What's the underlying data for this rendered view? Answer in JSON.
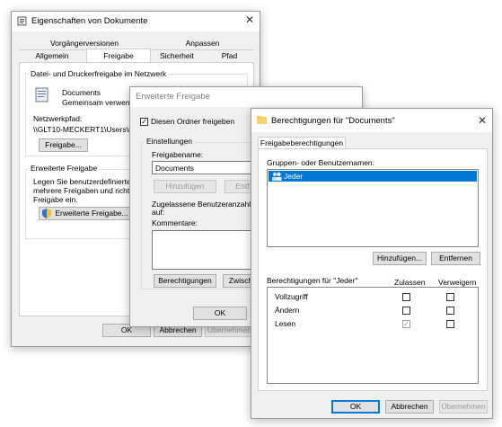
{
  "win1": {
    "title": "Eigenschaften von Dokumente",
    "tabs_row1": [
      "Vorgängerversionen",
      "Anpassen"
    ],
    "tabs_row2": [
      "Allgemein",
      "Freigabe",
      "Sicherheit",
      "Pfad"
    ],
    "net_group": "Datei- und Druckerfreigabe im Netzwerk",
    "folder_name": "Documents",
    "folder_status": "Gemeinsam verwendet",
    "path_label": "Netzwerkpfad:",
    "path_value": "\\\\GLT10-MECKERT1\\Users\\m",
    "share_button": "Freigabe...",
    "adv_group": "Erweiterte Freigabe",
    "adv_text1": "Legen Sie benutzerdefinierte Be",
    "adv_text2": "mehrere Freigaben und richten S",
    "adv_text3": "Freigabe ein.",
    "adv_button": "Erweiterte Freigabe...",
    "ok": "OK",
    "cancel": "Abbrechen",
    "apply": "Übernehmen"
  },
  "win2": {
    "title": "Erweiterte Freigabe",
    "share_check": "Diesen Ordner freigeben",
    "settings_group": "Einstellungen",
    "share_name_label": "Freigabename:",
    "share_name_value": "Documents",
    "add_button": "Hinzufügen",
    "remove_button": "Entf",
    "limit_label1": "Zugelassene Benutzeranzahl ei",
    "limit_label2": "auf:",
    "comments_label": "Kommentare:",
    "permissions_button": "Berechtigungen",
    "cache_button": "Zwisch",
    "ok": "OK"
  },
  "win3": {
    "title": "Berechtigungen für \"Documents\"",
    "tab": "Freigabeberechtigungen",
    "users_label": "Gruppen- oder Benutzernamen:",
    "users": [
      "Jeder"
    ],
    "add_button": "Hinzufügen...",
    "remove_button": "Entfernen",
    "perm_label": "Berechtigungen für \"Jeder\"",
    "allow_header": "Zulassen",
    "deny_header": "Verweigern",
    "permissions": [
      {
        "name": "Vollzugriff",
        "allow": false,
        "deny": false
      },
      {
        "name": "Ändern",
        "allow": false,
        "deny": false
      },
      {
        "name": "Lesen",
        "allow": true,
        "deny": false
      }
    ],
    "ok": "OK",
    "cancel": "Abbrechen",
    "apply": "Übernehmen"
  }
}
